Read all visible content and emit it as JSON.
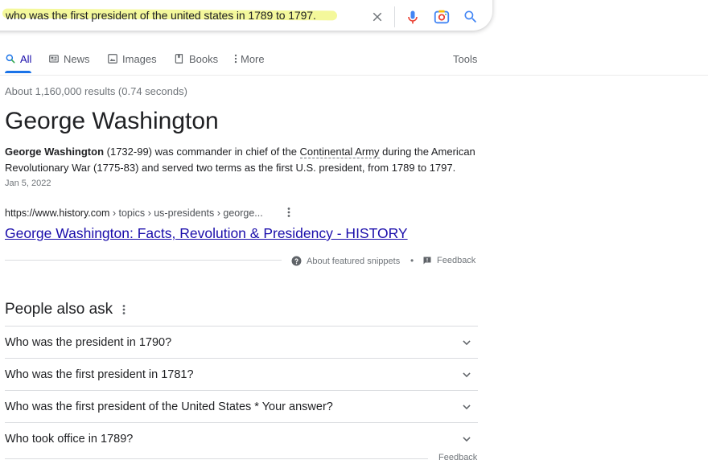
{
  "search": {
    "query": "who was the first president of the united states in 1789 to 1797.",
    "icons": [
      "close-icon",
      "microphone-icon",
      "camera-icon",
      "search-icon"
    ]
  },
  "tabs": [
    {
      "label": "All",
      "icon": "search-icon",
      "active": true
    },
    {
      "label": "News",
      "icon": "news-icon"
    },
    {
      "label": "Images",
      "icon": "image-icon"
    },
    {
      "label": "Books",
      "icon": "book-icon"
    },
    {
      "label": "More",
      "icon": "more-vertical-icon"
    }
  ],
  "tools_label": "Tools",
  "result_stats": "About 1,160,000 results (0.74 seconds)",
  "featured": {
    "answer": "George Washington",
    "snippet_bold": "George Washington",
    "snippet_part1": " (1732-99) was commander in chief of the ",
    "snippet_link": "Continental Army",
    "snippet_part2": " during the American Revolutionary War (1775-83) and served two terms as the first U.S. president, from 1789 to 1797.",
    "date": "Jan 5, 2022",
    "url_domain": "https://www.history.com",
    "url_path": " › topics › us-presidents › george...",
    "title": "George Washington: Facts, Revolution & Presidency - HISTORY",
    "about_label": "About featured snippets",
    "separator": "•",
    "feedback_label": "Feedback"
  },
  "people_also_ask": {
    "title": "People also ask",
    "questions": [
      "Who was the president in 1790?",
      "Who was the first president in 1781?",
      "Who was the first president of the United States * Your answer?",
      "Who took office in 1789?"
    ],
    "feedback_label": "Feedback"
  },
  "colors": {
    "link": "#1a0dab",
    "accent": "#1a73e8",
    "highlight": "#f0f57a",
    "mic_blue": "#4285f4"
  }
}
